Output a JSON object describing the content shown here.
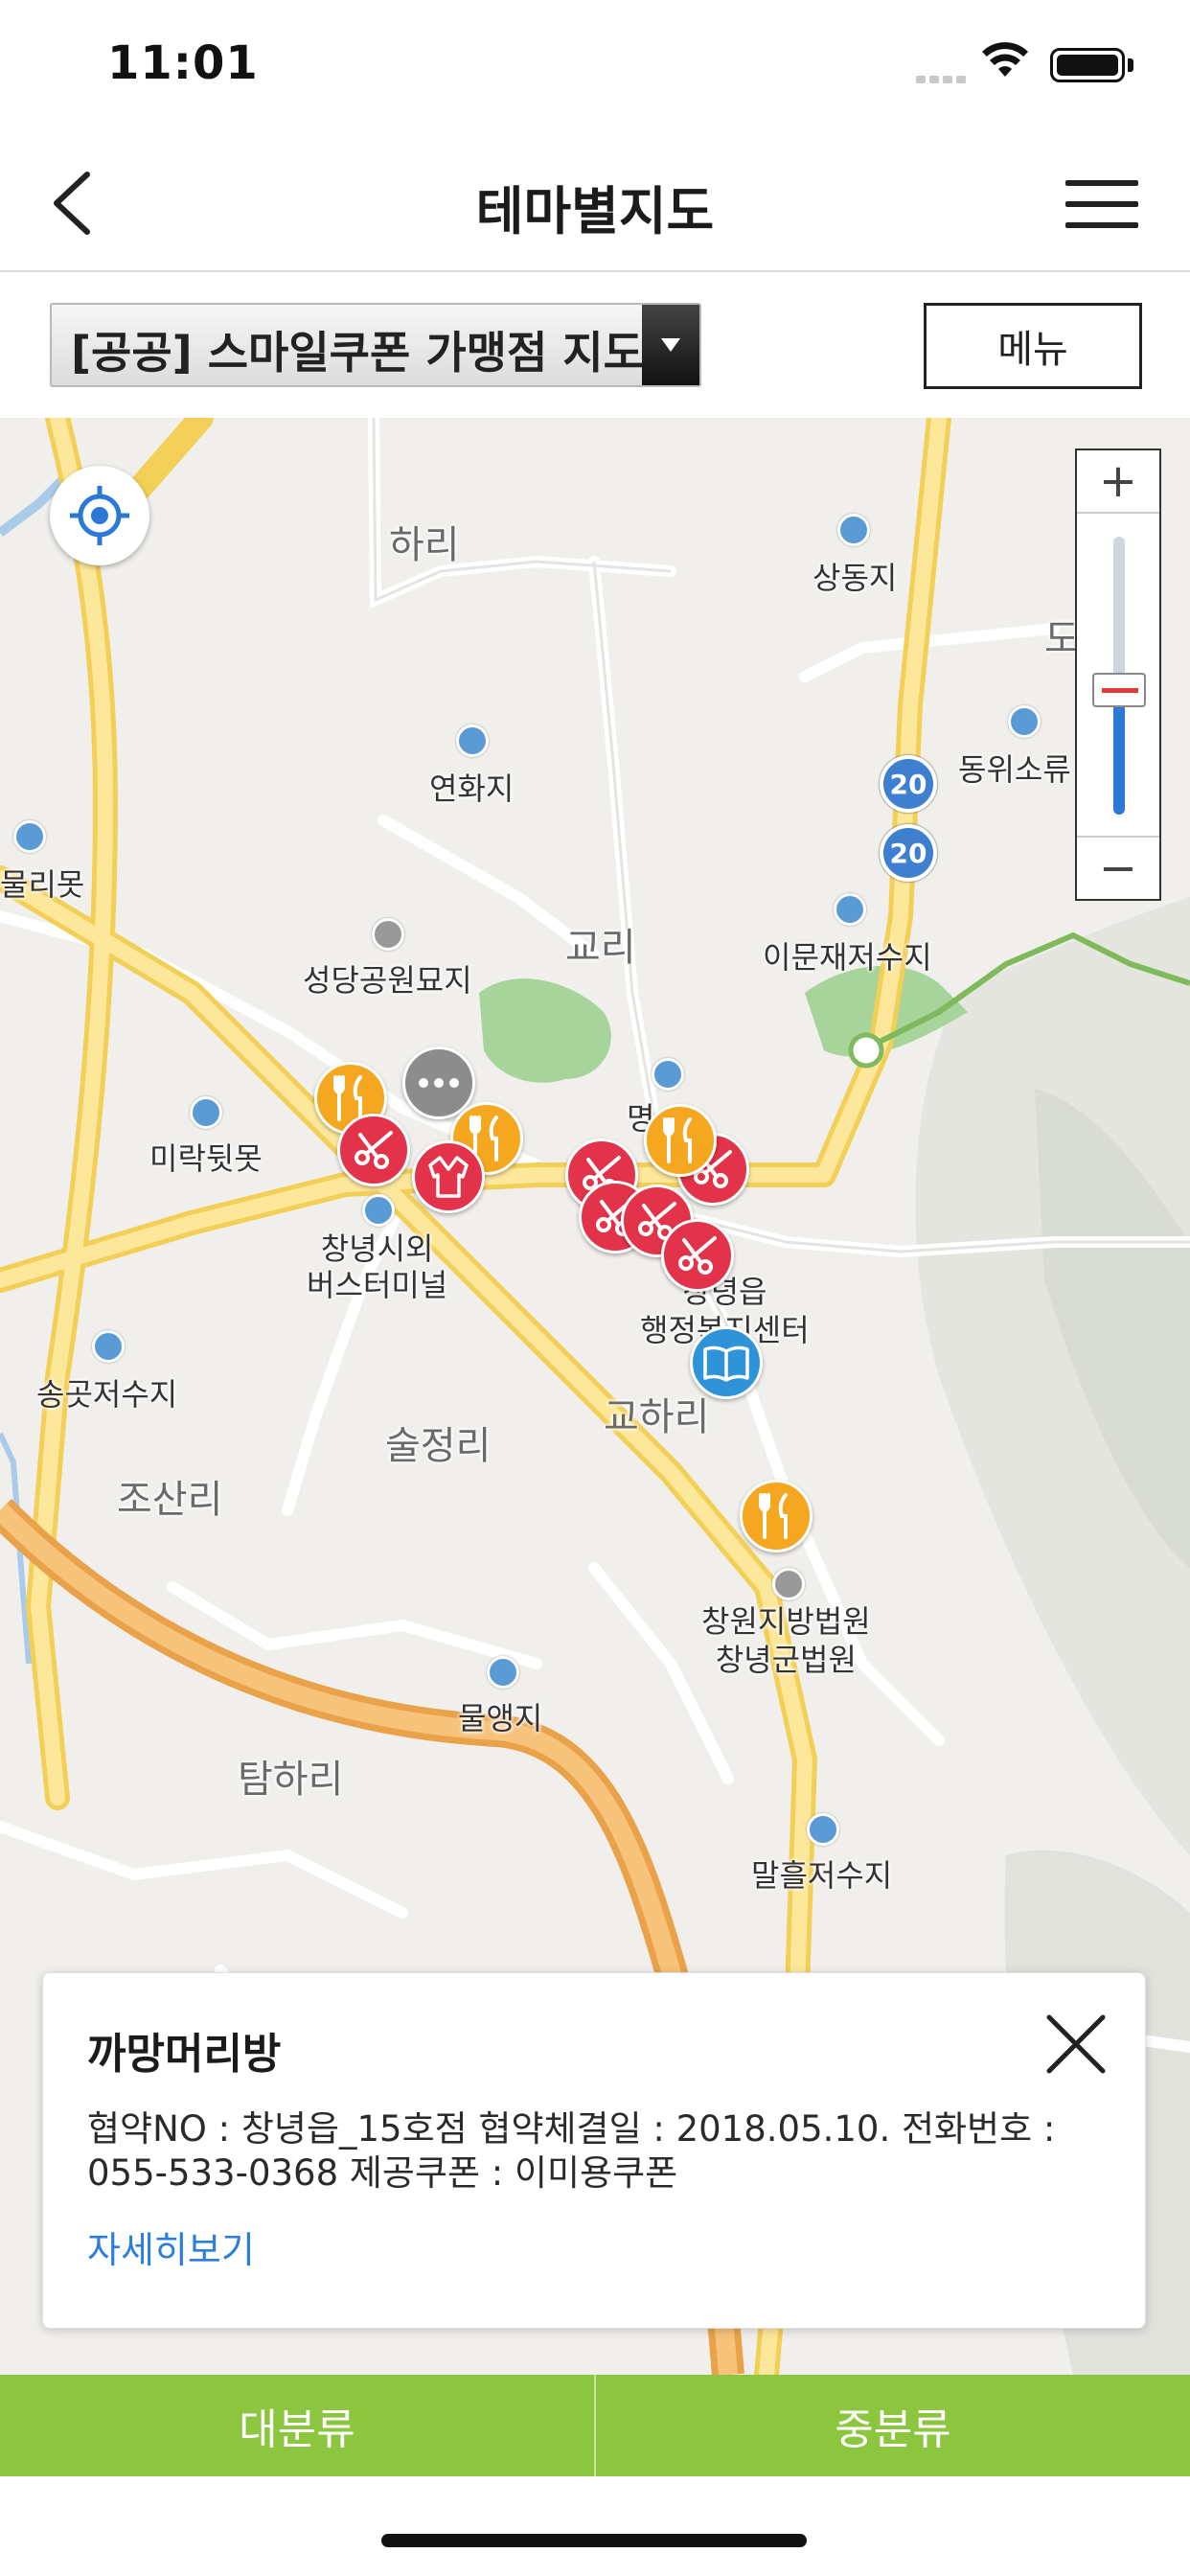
{
  "status_bar": {
    "time": "11:01"
  },
  "header": {
    "title": "테마별지도"
  },
  "filter": {
    "selected_theme": "[공공] 스마일쿠폰 가맹점 지도",
    "menu_label": "메뉴"
  },
  "map": {
    "labels": [
      {
        "name": "하리",
        "style": "big"
      },
      {
        "name": "상동지",
        "style": "small"
      },
      {
        "name": "연화지",
        "style": "small"
      },
      {
        "name": "동위소류",
        "style": "small"
      },
      {
        "name": "물리못",
        "style": "small"
      },
      {
        "name": "교리",
        "style": "big"
      },
      {
        "name": "성당공원묘지",
        "style": "small"
      },
      {
        "name": "이문재저수지",
        "style": "small"
      },
      {
        "name": "미락뒷못",
        "style": "small"
      },
      {
        "name": "창녕시외\n버스터미널",
        "style": "small"
      },
      {
        "name": "창녕읍\n행정복지센터",
        "style": "small"
      },
      {
        "name": "송곳저수지",
        "style": "small"
      },
      {
        "name": "술정리",
        "style": "big"
      },
      {
        "name": "교하리",
        "style": "big"
      },
      {
        "name": "조산리",
        "style": "big"
      },
      {
        "name": "창원지방법원\n창녕군법원",
        "style": "small"
      },
      {
        "name": "물앵지",
        "style": "small"
      },
      {
        "name": "탐하리",
        "style": "big"
      },
      {
        "name": "말흘저수지",
        "style": "small"
      },
      {
        "name": "명",
        "style": "small"
      },
      {
        "name": "도",
        "style": "big"
      }
    ],
    "route_badges": [
      "20",
      "20"
    ],
    "markers": [
      {
        "type": "food",
        "icon": "fork-knife-icon"
      },
      {
        "type": "more",
        "icon": "ellipsis-icon"
      },
      {
        "type": "hair",
        "icon": "scissors-icon"
      },
      {
        "type": "food",
        "icon": "fork-knife-icon"
      },
      {
        "type": "clothes",
        "icon": "shirt-icon"
      },
      {
        "type": "hair",
        "icon": "scissors-icon"
      },
      {
        "type": "food",
        "icon": "fork-knife-icon"
      },
      {
        "type": "hair",
        "icon": "scissors-icon"
      },
      {
        "type": "hair",
        "icon": "scissors-icon"
      },
      {
        "type": "hair",
        "icon": "scissors-icon"
      },
      {
        "type": "hair",
        "icon": "scissors-icon"
      },
      {
        "type": "library",
        "icon": "book-icon"
      },
      {
        "type": "food",
        "icon": "fork-knife-icon"
      }
    ],
    "zoom": {
      "in_label": "+",
      "out_label": "−",
      "level_fraction": 0.45
    }
  },
  "popup": {
    "title": "까망머리방",
    "description": "협약NO : 창녕읍_15호점 협약체결일 : 2018.05.10. 전화번호 : 055-533-0368 제공쿠폰 : 이미용쿠폰",
    "detail_link": "자세히보기"
  },
  "tabs": [
    {
      "label": "대분류"
    },
    {
      "label": "중분류"
    }
  ],
  "colors": {
    "accent_green": "#8cc63f",
    "food": "#f5a71f",
    "hair": "#e2334a",
    "link": "#2b7de0"
  }
}
